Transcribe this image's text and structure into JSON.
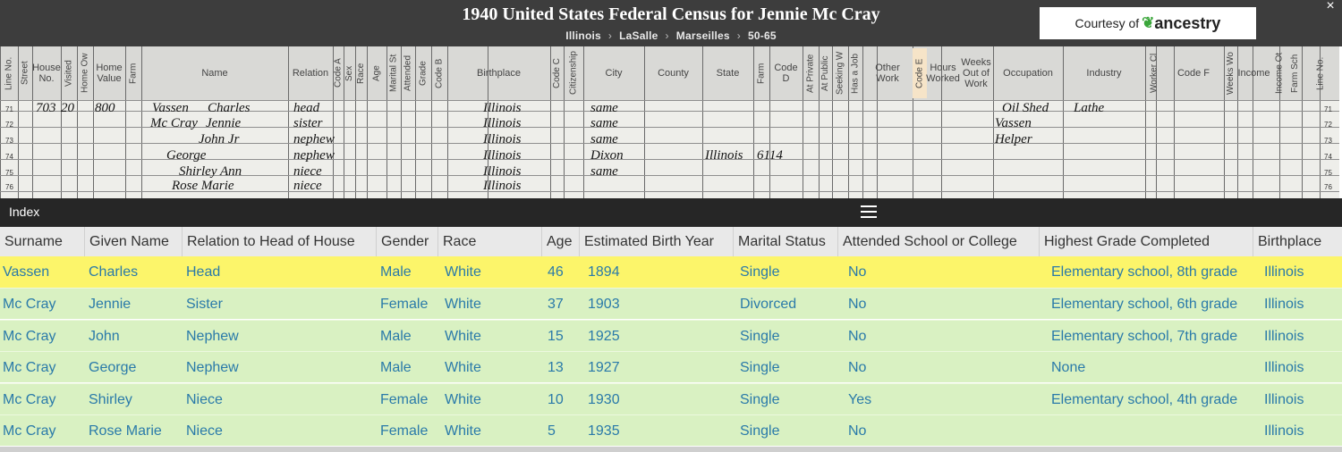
{
  "header": {
    "title": "1940 United States Federal Census for Jennie Mc Cray",
    "breadcrumb": [
      "Illinois",
      "LaSalle",
      "Marseilles",
      "50-65"
    ],
    "courtesy_prefix": "Courtesy of",
    "courtesy_brand": "ancestry",
    "close_label": "×"
  },
  "scan": {
    "headers": [
      "Line No.",
      "Street",
      "House No.",
      "Visited",
      "Home Ow",
      "Home Value",
      "Farm",
      "Name",
      "Relation",
      "Code A",
      "Sex",
      "Race",
      "Age",
      "Marital St",
      "Attended",
      "Grade",
      "Code B",
      "Birthplace",
      "Code C",
      "Citizenship",
      "City",
      "County",
      "State",
      "Farm",
      "Code D",
      "At Private",
      "At Public",
      "Seeking W",
      "Has a Job",
      "Other Work",
      "Code E",
      "Hours Worked",
      "Weeks Out of Work",
      "Occupation",
      "Industry",
      "Worker Cl",
      "Code F",
      "Weeks Wo",
      "Income",
      "Income Ot",
      "Farm Sch",
      "Line No."
    ],
    "line_numbers": [
      "71",
      "72",
      "73",
      "74",
      "75",
      "76"
    ],
    "handwriting": [
      "703",
      "20",
      "800",
      "Vassen",
      "Charles",
      "head",
      "Mc Cray",
      "Jennie",
      "sister",
      "John Jr",
      "nephew",
      "George",
      "nephew",
      "Shirley Ann",
      "niece",
      "Rose Marie",
      "niece",
      "Illinois",
      "Illinois",
      "Illinois",
      "Illinois",
      "Illinois",
      "Illinois",
      "same",
      "same",
      "same",
      "Dixon",
      "same",
      "Illinois",
      "6114",
      "Oil Shed",
      "Lathe",
      "Vassen",
      "Helper"
    ]
  },
  "index": {
    "label": "Index",
    "columns": [
      "Surname",
      "Given Name",
      "Relation to Head of House",
      "Gender",
      "Race",
      "Age",
      "Estimated Birth Year",
      "Marital Status",
      "Attended School or College",
      "Highest Grade Completed",
      "Birthplace"
    ],
    "rows": [
      [
        "Vassen",
        "Charles",
        "Head",
        "Male",
        "White",
        "46",
        "1894",
        "Single",
        "No",
        "Elementary school, 8th grade",
        "Illinois"
      ],
      [
        "Mc Cray",
        "Jennie",
        "Sister",
        "Female",
        "White",
        "37",
        "1903",
        "Divorced",
        "No",
        "Elementary school, 6th grade",
        "Illinois"
      ],
      [
        "Mc Cray",
        "John",
        "Nephew",
        "Male",
        "White",
        "15",
        "1925",
        "Single",
        "No",
        "Elementary school, 7th grade",
        "Illinois"
      ],
      [
        "Mc Cray",
        "George",
        "Nephew",
        "Male",
        "White",
        "13",
        "1927",
        "Single",
        "No",
        "None",
        "Illinois"
      ],
      [
        "Mc Cray",
        "Shirley",
        "Niece",
        "Female",
        "White",
        "10",
        "1930",
        "Single",
        "Yes",
        "Elementary school, 4th grade",
        "Illinois"
      ],
      [
        "Mc Cray",
        "Rose Marie",
        "Niece",
        "Female",
        "White",
        "5",
        "1935",
        "Single",
        "No",
        "",
        "Illinois"
      ]
    ],
    "selected_row": 0
  },
  "colors": {
    "selected_row": "#fcf56a",
    "row": "#d9f1c2",
    "cell_text": "#2a7aa9",
    "header_bar": "#3d3d3d",
    "index_bar": "#262626"
  }
}
